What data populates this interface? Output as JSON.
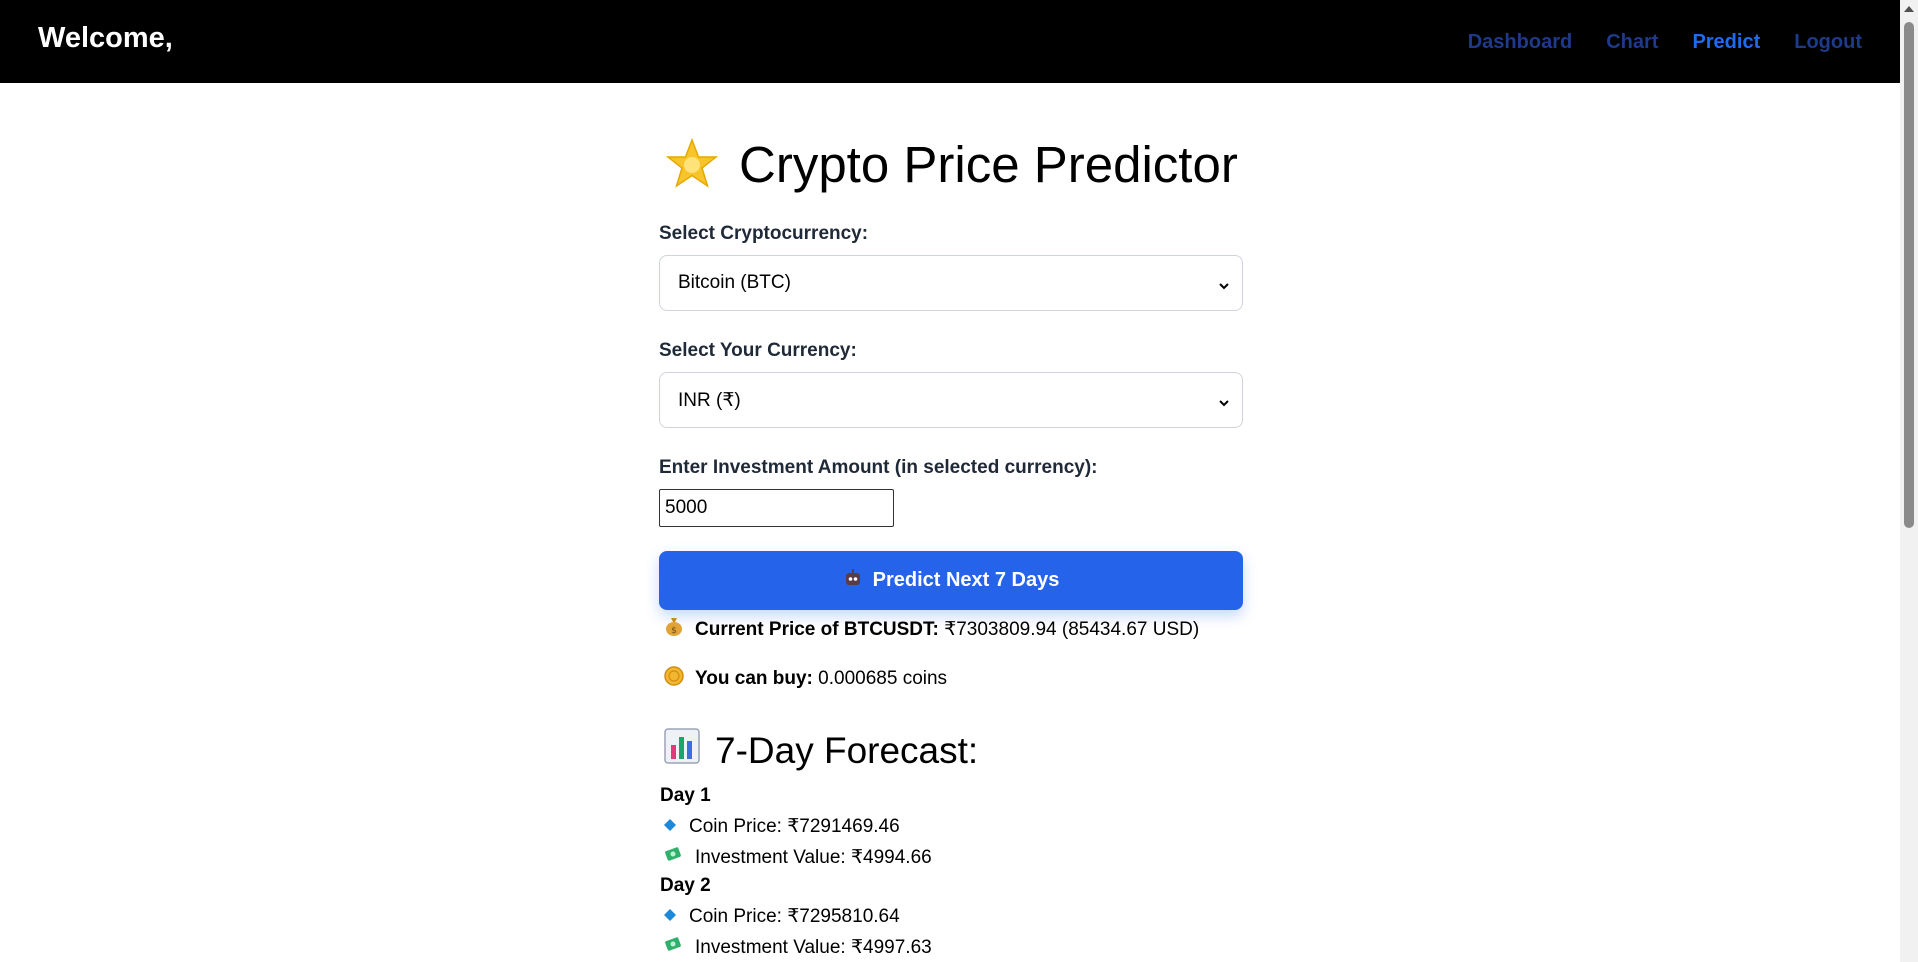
{
  "nav": {
    "brand": "Welcome,",
    "links": [
      "Dashboard",
      "Chart",
      "Predict",
      "Logout"
    ]
  },
  "page": {
    "title": "Crypto Price Predictor",
    "crypto_label": "Select Cryptocurrency:",
    "crypto_value": "Bitcoin (BTC)",
    "currency_label": "Select Your Currency:",
    "currency_value": "INR (₹)",
    "amount_label": "Enter Investment Amount (in selected currency):",
    "amount_value": "5000",
    "predict_button": "Predict Next 7 Days",
    "current_price_label": "Current Price of BTCUSDT:",
    "current_price_value": "₹7303809.94 (85434.67 USD)",
    "can_buy_label": "You can buy:",
    "can_buy_value": "0.000685 coins",
    "forecast_title": "7-Day Forecast:"
  },
  "forecast": [
    {
      "day": "Day 1",
      "coin_price": "Coin Price: ₹7291469.46",
      "investment": "Investment Value: ₹4994.66"
    },
    {
      "day": "Day 2",
      "coin_price": "Coin Price: ₹7295810.64",
      "investment": "Investment Value: ₹4997.63"
    }
  ],
  "icons": {
    "title": "star-icon",
    "predict": "robot-icon",
    "price": "money-bag-icon",
    "buy": "coin-icon",
    "forecast": "bar-chart-icon",
    "coin_price": "diamond-icon",
    "investment": "money-wings-icon"
  },
  "colors": {
    "navbar": "#000000",
    "nav_link": "#1e3a8a",
    "nav_active": "#1d6cf0",
    "button": "#2563eb"
  }
}
